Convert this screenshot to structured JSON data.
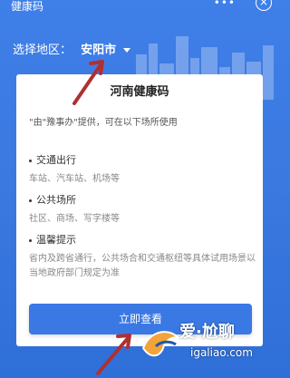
{
  "header": {
    "title": "健康码",
    "more": "•••",
    "close": "⊗"
  },
  "region": {
    "label": "选择地区：",
    "value": "安阳市"
  },
  "card": {
    "title": "河南健康码",
    "intro": "\"由\"豫事办\"提供，可在以下场所使用",
    "sections": [
      {
        "heading": "交通出行",
        "desc": "车站、汽车站、机场等"
      },
      {
        "heading": "公共场所",
        "desc": "社区、商场、写字楼等"
      },
      {
        "heading": "温馨提示",
        "desc": "省内及跨省通行，公共场合和交通枢纽等具体试用场景以当地政府部门规定为准"
      }
    ]
  },
  "cta": {
    "label": "立即查看"
  },
  "watermark": {
    "brand": "爱·尬聊",
    "url": "igaliao.com"
  },
  "colors": {
    "primary": "#3a78e4",
    "annotation": "#b03030"
  }
}
